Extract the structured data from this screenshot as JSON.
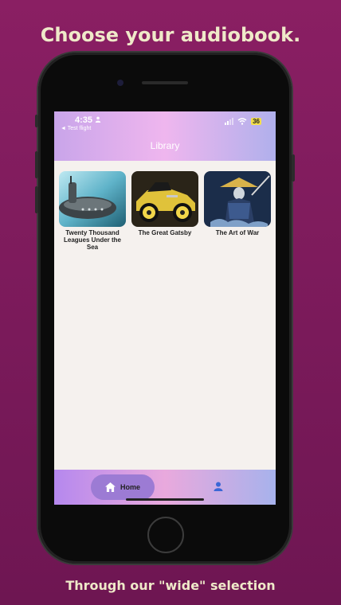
{
  "promo": {
    "headline": "Choose your audiobook.",
    "footline": "Through our \"wide\" selection"
  },
  "status_bar": {
    "time": "4:35",
    "back_app": "◄ Test flight",
    "battery": "36"
  },
  "header": {
    "title": "Library"
  },
  "books": [
    {
      "title": "Twenty Thousand Leagues Under the Sea"
    },
    {
      "title": "The Great Gatsby"
    },
    {
      "title": "The Art of War"
    }
  ],
  "tabbar": {
    "home_label": "Home",
    "home_icon": "house-icon",
    "profile_icon": "person-icon"
  },
  "colors": {
    "background": "#8a1f63",
    "headline_text": "#efe9c9",
    "active_tab": "#9c7bd4",
    "profile_icon": "#3a67d6"
  }
}
